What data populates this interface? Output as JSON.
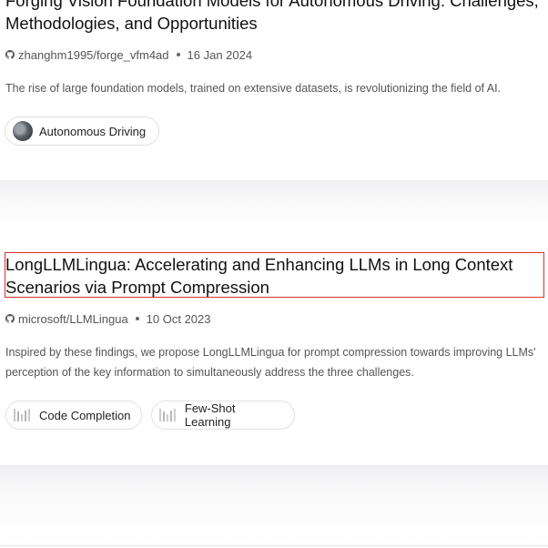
{
  "papers": [
    {
      "title": "Forging Vision Foundation Models for Autonomous Driving: Challenges, Methodologies, and Opportunities",
      "repo": "zhanghm1995/forge_vfm4ad",
      "date": "16 Jan 2024",
      "description": "The rise of large foundation models, trained on extensive datasets, is revolutionizing the field of AI.",
      "tags": [
        {
          "label": "Autonomous Driving",
          "icon": "thumbnail-image-icon"
        }
      ]
    },
    {
      "title": "LongLLMLingua: Accelerating and Enhancing LLMs in Long Context Scenarios via Prompt Compression",
      "repo": "microsoft/LLMLingua",
      "date": "10 Oct 2023",
      "description": "Inspired by these findings, we propose LongLLMLingua for prompt compression towards improving LLMs' perception of the key information to simultaneously address the three challenges.",
      "tags": [
        {
          "label": "Code Completion",
          "icon": "bar-chart-icon"
        },
        {
          "label": "Few-Shot Learning",
          "icon": "bar-chart-icon"
        }
      ]
    }
  ],
  "colors": {
    "highlight_border": "#d9312b",
    "meta_text": "#555555"
  }
}
